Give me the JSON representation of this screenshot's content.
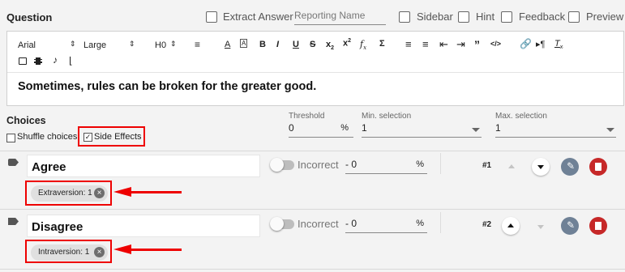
{
  "header": {
    "title": "Question",
    "extract_answer_label": "Extract Answer",
    "reporting_name_placeholder": "Reporting Name",
    "sidebar_label": "Sidebar",
    "hint_label": "Hint",
    "feedback_label": "Feedback",
    "preview_label": "Preview"
  },
  "toolbar": {
    "font_family": "Arial",
    "font_size": "Large",
    "heading": "H0",
    "icons": [
      "align-left-icon",
      "text-color-icon",
      "highlight-icon",
      "bold-icon",
      "italic-icon",
      "underline-icon",
      "strikethrough-icon",
      "subscript-icon",
      "superscript-icon",
      "formula-icon",
      "sigma-icon",
      "numbered-list-icon",
      "bulleted-list-icon",
      "outdent-icon",
      "indent-icon",
      "quote-icon",
      "code-icon",
      "link-icon",
      "paragraph-icon",
      "clear-format-icon",
      "image-icon",
      "video-icon",
      "audio-icon",
      "attachment-icon"
    ]
  },
  "question_text": "Sometimes, rules can be broken for the greater good.",
  "choices": {
    "title": "Choices",
    "shuffle_label": "Shuffle choices",
    "side_effects_label": "Side Effects",
    "side_effects_checked": true,
    "threshold_label": "Threshold",
    "threshold_value": "0",
    "threshold_unit": "%",
    "min_selection_label": "Min. selection",
    "min_selection_value": "1",
    "max_selection_label": "Max. selection",
    "max_selection_value": "1",
    "items": [
      {
        "text": "Agree",
        "status": "Incorrect",
        "score": "- 0",
        "score_unit": "%",
        "number": "#1",
        "tag": "Extraversion: 1"
      },
      {
        "text": "Disagree",
        "status": "Incorrect",
        "score": "- 0",
        "score_unit": "%",
        "number": "#2",
        "tag": "Intraversion: 1"
      }
    ]
  },
  "colors": {
    "annotation_red": "#e00000",
    "edit_button": "#6f8196",
    "delete_button": "#c62828"
  }
}
